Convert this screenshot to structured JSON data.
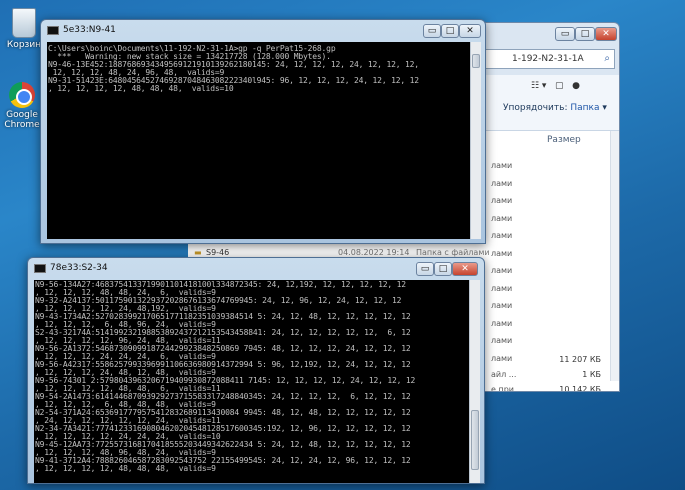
{
  "desktop": {
    "recycle_label": "Корзин",
    "chrome_label_1": "Google",
    "chrome_label_2": "Chrome"
  },
  "explorer": {
    "address": "1-192-N2-31-1A",
    "sort_label": "Упорядочить:",
    "folder_label": "Папка",
    "column_size": "Размер",
    "rows_label": "лами",
    "rows": [
      {
        "name": "лами",
        "size": ""
      },
      {
        "name": "лами",
        "size": ""
      },
      {
        "name": "лами",
        "size": ""
      },
      {
        "name": "лами",
        "size": ""
      },
      {
        "name": "лами",
        "size": ""
      },
      {
        "name": "лами",
        "size": ""
      },
      {
        "name": "лами",
        "size": ""
      },
      {
        "name": "лами",
        "size": ""
      },
      {
        "name": "лами",
        "size": ""
      },
      {
        "name": "лами",
        "size": ""
      },
      {
        "name": "лами",
        "size": ""
      },
      {
        "name": "лами",
        "size": ""
      }
    ],
    "sizes": [
      {
        "name": "",
        "size": "11 207 КБ"
      },
      {
        "name": "айл ...",
        "size": "1 КБ"
      },
      {
        "name": "е при...",
        "size": "10 142 КБ"
      },
      {
        "name": "",
        "size": "4 КБ"
      }
    ],
    "strip_name": "S9-46",
    "strip_date": "04.08.2022 19:14",
    "strip_type": "Папка с файлами"
  },
  "console_top": {
    "title": "5e33:N9-41",
    "lines": [
      "C:\\Users\\boinc\\Documents\\11-192-N2-31-1A>gp -q PerPat15-268.gp",
      "  ***   Warning: new stack size = 134217728 (128.000 Mbytes).",
      "N9-46-13E452:1887686934349569121910139262180145: 24, 12, 12, 12, 24, 12, 12, 12,",
      " 12, 12, 12, 48, 24, 96, 48,  valids=9",
      "N9-31-51423E:6480456452746928704846308222340l945: 96, 12, 12, 12, 24, 12, 12, 12",
      ", 12, 12, 12, 12, 48, 48, 48,  valids=10"
    ]
  },
  "console_bottom": {
    "title": "78e33:S2-34",
    "lines": [
      "N9-56-134A27:4683754133719901101418100l334872345: 24, 12,192, 12, 12, 12, 12, 12",
      ", 12, 12, 12, 48, 48, 24,  6,  valids=9",
      "N9-32-A24137:5011759013229372028676133674769945: 24, 12, 96, 12, 24, 12, 12, 12",
      ", 12, 12, 12, 12, 24, 48,192,  valids=9",
      "N9-43-1734A2:5270283992170651771182351039384514 5: 24, 12, 48, 12, 12, 12, 12, 12",
      ", 12, 12, 12,  6, 48, 96, 24,  valids=9",
      "S2-43-32174A:5141992321988538924372l2153543458841: 24, 12, 12, 12, 12, 12,  6, 12",
      ", 12, 12, 12, 12, 96, 24, 48,  valids=11",
      "N9-56-2A1372:5468730909918724429923848250869 7945: 48, 12, 12, 12, 24, 12, 12, 12",
      ", 12, 12, 12, 24, 24, 24,  6,  valids=9",
      "N9-56-A42317:5586257993396991106636980914372994 5: 96, 12,192, 12, 24, 12, 12, 12",
      ", 12, 12, 12, 24, 48, 12, 48,  valids=9",
      "N9-56-74301 2:5798043963206719409930872088411 7145: 12, 12, 12, 12, 24, 12, 12, 12",
      ", 12, 12, 12, 12, 48, 48,  6,  valids=11",
      "N9-54-2A1473:6141446870939292737155833l7248840345: 24, 12, 12, 12,  6, 12, 12, 12",
      ", 12, 12, 12,  6, 48, 48, 48,  valids=9",
      "N2-54-371A24:6536917779575412832689113430084 9945: 48, 12, 48, 12, 12, 12, 12, 12",
      ", 24, 12, 12, 12, 12, 12, 24,  valids=11",
      "N2-34-7A3421:777412331690804620204548128517600345:192, 12, 96, 12, 12, 12, 12, 12",
      ", 12, 12, 12, 12, 24, 24, 24,  valids=10",
      "N9-45-12AA73:7725573168170418555203449342622434 5: 24, 12, 48, 12, 12, 12, 12, 12",
      ", 12, 12, 12, 48, 96, 48, 24,  valids=9",
      "N9-41-3712A4:788826046587283092543752 22155499545: 24, 12, 24, 12, 96, 12, 12, 12",
      ", 12, 12, 12, 12, 48, 48, 48,  valids=9"
    ]
  },
  "window_controls": {
    "minimize": "▭",
    "maximize": "□",
    "close": "✕"
  }
}
